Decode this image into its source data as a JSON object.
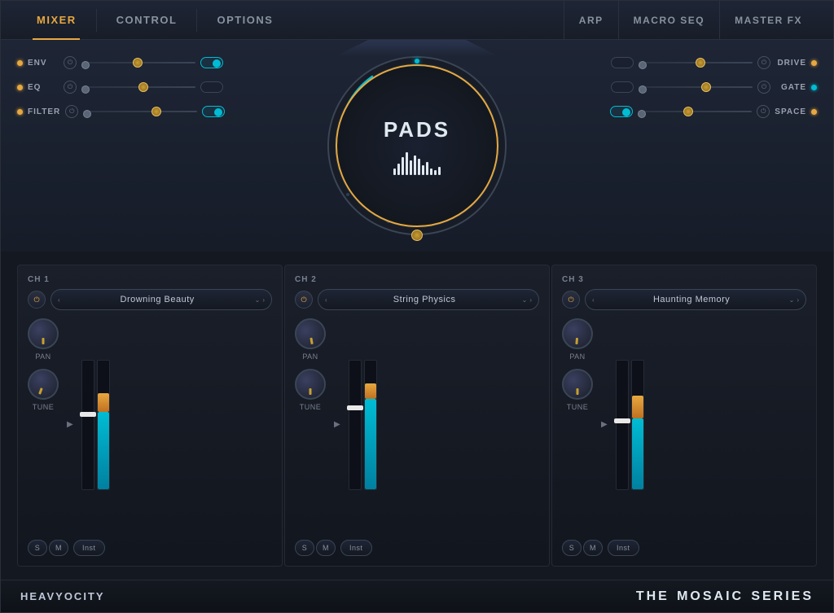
{
  "nav": {
    "items": [
      {
        "id": "mixer",
        "label": "MIXER",
        "active": true
      },
      {
        "id": "control",
        "label": "CONTROL",
        "active": false
      },
      {
        "id": "options",
        "label": "OPTIONS",
        "active": false
      }
    ],
    "right_items": [
      {
        "id": "arp",
        "label": "ARP"
      },
      {
        "id": "macro_seq",
        "label": "MACRO SEQ"
      },
      {
        "id": "master_fx",
        "label": "MASTER FX"
      }
    ]
  },
  "pads": {
    "title": "PADS",
    "left_controls": [
      {
        "label": "ENV",
        "id": "env"
      },
      {
        "label": "EQ",
        "id": "eq"
      },
      {
        "label": "FILTER",
        "id": "filter"
      }
    ],
    "right_controls": [
      {
        "label": "DRIVE",
        "id": "drive"
      },
      {
        "label": "GATE",
        "id": "gate"
      },
      {
        "label": "SPACE",
        "id": "space"
      }
    ]
  },
  "channels": [
    {
      "id": "ch1",
      "label": "CH 1",
      "preset": "Drowning Beauty",
      "pan_label": "PAN",
      "tune_label": "TUNE",
      "s_label": "S",
      "m_label": "M",
      "inst_label": "Inst"
    },
    {
      "id": "ch2",
      "label": "CH 2",
      "preset": "String Physics",
      "pan_label": "PAN",
      "tune_label": "TUNE",
      "s_label": "S",
      "m_label": "M",
      "inst_label": "Inst"
    },
    {
      "id": "ch3",
      "label": "CH 3",
      "preset": "Haunting Memory",
      "pan_label": "PAN",
      "tune_label": "TUNE",
      "s_label": "S",
      "m_label": "M",
      "inst_label": "Inst"
    }
  ],
  "footer": {
    "brand": "HEAVYOCITY",
    "series_prefix": "THE",
    "series_name": "MOSAIC",
    "series_suffix": "SERIES"
  },
  "colors": {
    "accent_amber": "#e8a840",
    "accent_cyan": "#00bcd4",
    "bg_dark": "#141820",
    "bg_mid": "#1a2030",
    "text_primary": "#e0e8f0",
    "text_secondary": "#8a9aaa"
  }
}
